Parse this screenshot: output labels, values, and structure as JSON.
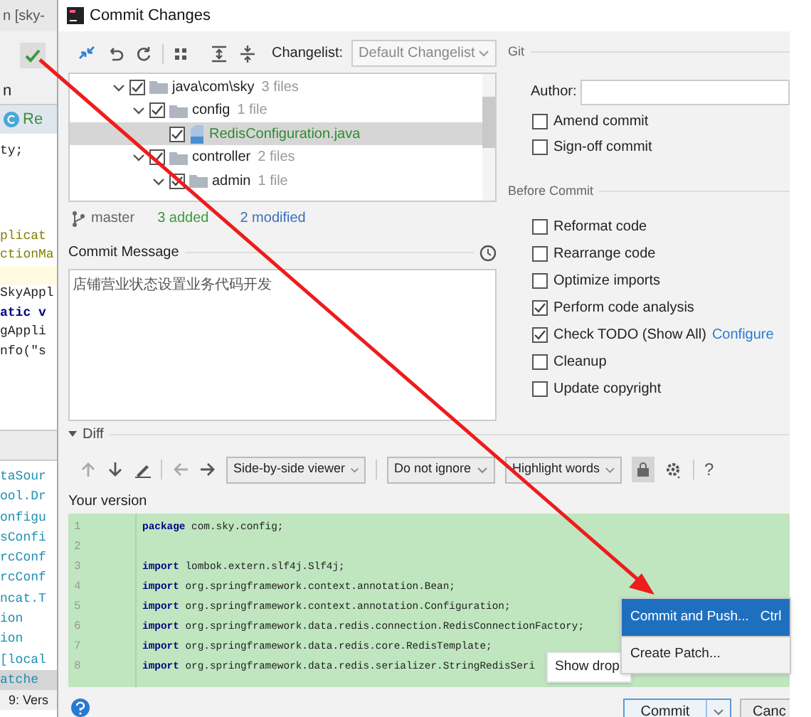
{
  "window": {
    "title": "Commit Changes"
  },
  "ide_background": {
    "title_fragment": "n [sky-",
    "panel_fragment": "n",
    "file_tab": "Re",
    "code_groups": [
      [
        {
          "text": "ty;",
          "kind": "plain"
        }
      ],
      [
        {
          "text": "plicat",
          "kind": "annotation"
        },
        {
          "text": "ctionMa",
          "kind": "annotation"
        }
      ],
      [
        {
          "text": "SkyAppl",
          "kind": "plain"
        },
        {
          "text": "atic v",
          "kind": "keyword"
        },
        {
          "text": "gAppli",
          "kind": "plain"
        },
        {
          "text": "nfo(\"s",
          "kind": "plain"
        }
      ]
    ],
    "list_fragments": [
      {
        "text": "taSour",
        "selected": false
      },
      {
        "text": "ool.Dr",
        "selected": false
      },
      {
        "text": "onfigu",
        "selected": false
      },
      {
        "text": "sConfi",
        "selected": false
      },
      {
        "text": "rcConf",
        "selected": false
      },
      {
        "text": "rcConf",
        "selected": false
      },
      {
        "text": "ncat.T",
        "selected": false
      },
      {
        "text": "ion",
        "selected": false
      },
      {
        "text": "ion",
        "selected": false
      },
      {
        "text": "[local",
        "selected": false
      },
      {
        "text": "atche",
        "selected": true
      }
    ],
    "tool_window": "9: Vers"
  },
  "toolbar": {
    "changelist_label": "Changelist:",
    "changelist": "Default Changelist"
  },
  "tree": [
    {
      "name": "java\\com\\sky",
      "count": "3 files",
      "kind": "folder",
      "checked": true,
      "expanded": true,
      "selected": false,
      "children": [
        {
          "name": "config",
          "count": "1 file",
          "kind": "folder",
          "checked": true,
          "expanded": true,
          "selected": false,
          "children": [
            {
              "name": "RedisConfiguration.java",
              "kind": "file",
              "checked": true,
              "selected": true
            }
          ]
        },
        {
          "name": "controller",
          "count": "2 files",
          "kind": "folder",
          "checked": true,
          "expanded": true,
          "selected": false,
          "children": [
            {
              "name": "admin",
              "count": "1 file",
              "kind": "folder",
              "checked": true,
              "expanded": true,
              "selected": false
            }
          ]
        }
      ]
    }
  ],
  "status": {
    "branch": "master",
    "added": "3 added",
    "modified": "2 modified"
  },
  "commit_message": {
    "label": "Commit Message",
    "value": "店铺营业状态设置业务代码开发"
  },
  "git": {
    "title": "Git",
    "author_label": "Author:",
    "options": [
      {
        "label": "Amend commit",
        "checked": false
      },
      {
        "label": "Sign-off commit",
        "checked": false
      }
    ]
  },
  "before_commit": {
    "title": "Before Commit",
    "options": [
      {
        "label": "Reformat code",
        "checked": false
      },
      {
        "label": "Rearrange code",
        "checked": false
      },
      {
        "label": "Optimize imports",
        "checked": false
      },
      {
        "label": "Perform code analysis",
        "checked": true
      },
      {
        "label": "Check TODO (Show All)",
        "checked": true,
        "link": "Configure"
      },
      {
        "label": "Cleanup",
        "checked": false
      },
      {
        "label": "Update copyright",
        "checked": false
      }
    ]
  },
  "diff": {
    "title": "Diff",
    "expanded": true,
    "viewer": "Side-by-side viewer",
    "whitespace": "Do not ignore",
    "highlight": "Highlight words",
    "help": "?",
    "version_label": "Your version",
    "lines": [
      {
        "number": "1",
        "keyword": "package",
        "text": "com.sky.config;"
      },
      {
        "number": "2"
      },
      {
        "number": "3",
        "keyword": "import",
        "text": "lombok.extern.slf4j.Slf4j;"
      },
      {
        "number": "4",
        "keyword": "import",
        "text": "org.springframework.context.annotation.Bean;"
      },
      {
        "number": "5",
        "keyword": "import",
        "text": "org.springframework.context.annotation.Configuration;"
      },
      {
        "number": "6",
        "keyword": "import",
        "text": "org.springframework.data.redis.connection.RedisConnectionFactory;"
      },
      {
        "number": "7",
        "keyword": "import",
        "text": "org.springframework.data.redis.core.RedisTemplate;"
      },
      {
        "number": "8",
        "keyword": "import",
        "text": "org.springframework.data.redis.serializer.StringRedisSeri"
      }
    ]
  },
  "commit_menu": [
    {
      "label": "Commit and Push...",
      "shortcut": "Ctrl",
      "selected": true
    },
    {
      "label": "Create Patch...",
      "selected": false
    }
  ],
  "tooltip": "Show drop",
  "buttons": {
    "commit": "Commit",
    "cancel": "Canc"
  }
}
